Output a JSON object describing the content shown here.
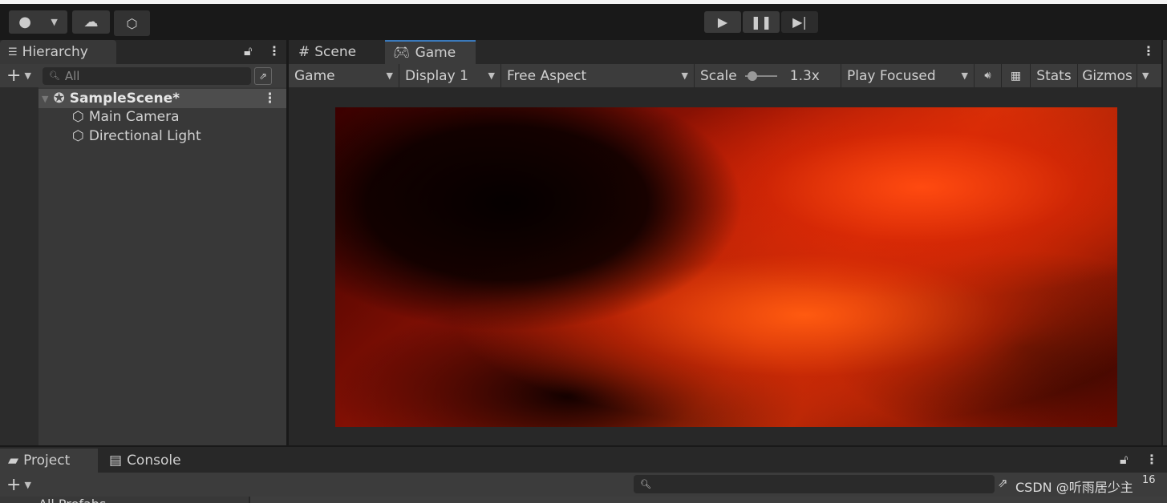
{
  "toolbar": {
    "account_icon": "account-icon",
    "cloud_icon": "cloud-icon",
    "collab_icon": "plastic-scm-icon",
    "play_icon": "play-icon",
    "pause_icon": "pause-icon",
    "step_icon": "step-icon"
  },
  "hierarchy": {
    "title": "Hierarchy",
    "search_placeholder": "All",
    "scene": "SampleScene*",
    "items": [
      {
        "label": "Main Camera"
      },
      {
        "label": "Directional Light"
      }
    ]
  },
  "game": {
    "tabs": [
      {
        "label": "Scene"
      },
      {
        "label": "Game"
      }
    ],
    "view_mode": "Game",
    "display": "Display 1",
    "aspect": "Free Aspect",
    "scale_label": "Scale",
    "scale_value": "1.3x",
    "scale_fraction": 0.2,
    "play_mode": "Play Focused",
    "stats": "Stats",
    "gizmos": "Gizmos"
  },
  "bottom": {
    "tabs": [
      {
        "label": "Project"
      },
      {
        "label": "Console"
      }
    ],
    "tree_item": "All Prefabs",
    "watermark": "CSDN @听雨居少主",
    "count": "16"
  },
  "colors": {
    "accent": "#3a79bb",
    "panel": "#383838",
    "toolbar": "#3c3c3c"
  }
}
